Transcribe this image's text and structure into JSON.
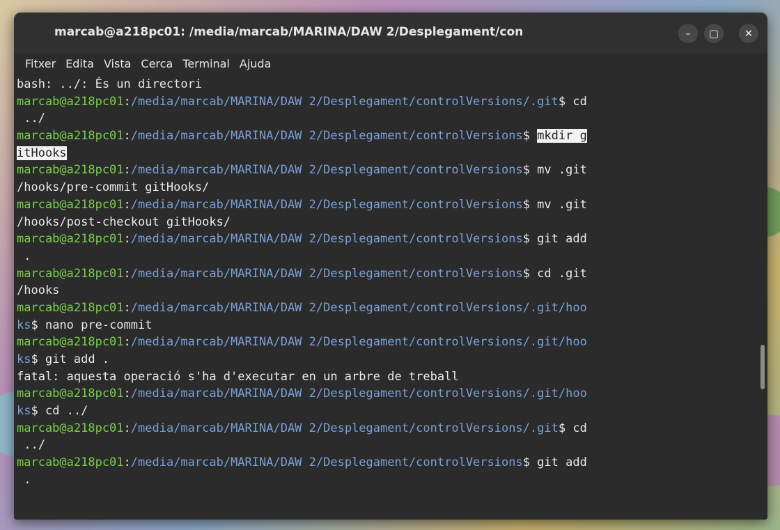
{
  "window": {
    "title": "marcab@a218pc01: /media/marcab/MARINA/DAW 2/Desplegament/con",
    "buttons": {
      "minimize": "–",
      "maximize": "▢",
      "close": "✕"
    }
  },
  "menu": [
    "Fitxer",
    "Edita",
    "Vista",
    "Cerca",
    "Terminal",
    "Ajuda"
  ],
  "colors": {
    "prompt_user": "#78d048",
    "prompt_path": "#7aa0d8",
    "text": "#e9e9e9",
    "background": "#2b2b2b"
  },
  "terminal": {
    "lines": [
      {
        "segments": [
          {
            "t": "bash: ../: És un directori",
            "c": "text"
          }
        ]
      },
      {
        "segments": [
          {
            "t": "marcab@a218pc01",
            "c": "user"
          },
          {
            "t": ":",
            "c": "text"
          },
          {
            "t": "/media/marcab/MARINA/DAW 2/Desplegament/controlVersions/.git",
            "c": "path"
          },
          {
            "t": "$ cd",
            "c": "text"
          }
        ]
      },
      {
        "segments": [
          {
            "t": " ../",
            "c": "text"
          }
        ]
      },
      {
        "segments": [
          {
            "t": "marcab@a218pc01",
            "c": "user"
          },
          {
            "t": ":",
            "c": "text"
          },
          {
            "t": "/media/marcab/MARINA/DAW 2/Desplegament/controlVersions",
            "c": "path"
          },
          {
            "t": "$ ",
            "c": "text"
          },
          {
            "t": "mkdir g",
            "c": "hl"
          }
        ]
      },
      {
        "segments": [
          {
            "t": "itHooks",
            "c": "hl"
          }
        ]
      },
      {
        "segments": [
          {
            "t": "marcab@a218pc01",
            "c": "user"
          },
          {
            "t": ":",
            "c": "text"
          },
          {
            "t": "/media/marcab/MARINA/DAW 2/Desplegament/controlVersions",
            "c": "path"
          },
          {
            "t": "$ mv .git",
            "c": "text"
          }
        ]
      },
      {
        "segments": [
          {
            "t": "/hooks/pre-commit gitHooks/",
            "c": "text"
          }
        ]
      },
      {
        "segments": [
          {
            "t": "marcab@a218pc01",
            "c": "user"
          },
          {
            "t": ":",
            "c": "text"
          },
          {
            "t": "/media/marcab/MARINA/DAW 2/Desplegament/controlVersions",
            "c": "path"
          },
          {
            "t": "$ mv .git",
            "c": "text"
          }
        ]
      },
      {
        "segments": [
          {
            "t": "/hooks/post-checkout gitHooks/",
            "c": "text"
          }
        ]
      },
      {
        "segments": [
          {
            "t": "marcab@a218pc01",
            "c": "user"
          },
          {
            "t": ":",
            "c": "text"
          },
          {
            "t": "/media/marcab/MARINA/DAW 2/Desplegament/controlVersions",
            "c": "path"
          },
          {
            "t": "$ git add",
            "c": "text"
          }
        ]
      },
      {
        "segments": [
          {
            "t": " .",
            "c": "text"
          }
        ]
      },
      {
        "segments": [
          {
            "t": "marcab@a218pc01",
            "c": "user"
          },
          {
            "t": ":",
            "c": "text"
          },
          {
            "t": "/media/marcab/MARINA/DAW 2/Desplegament/controlVersions",
            "c": "path"
          },
          {
            "t": "$ cd .git",
            "c": "text"
          }
        ]
      },
      {
        "segments": [
          {
            "t": "/hooks",
            "c": "text"
          }
        ]
      },
      {
        "segments": [
          {
            "t": "marcab@a218pc01",
            "c": "user"
          },
          {
            "t": ":",
            "c": "text"
          },
          {
            "t": "/media/marcab/MARINA/DAW 2/Desplegament/controlVersions/.git/hoo",
            "c": "path"
          }
        ]
      },
      {
        "segments": [
          {
            "t": "ks",
            "c": "path"
          },
          {
            "t": "$ nano pre-commit",
            "c": "text"
          }
        ]
      },
      {
        "segments": [
          {
            "t": "marcab@a218pc01",
            "c": "user"
          },
          {
            "t": ":",
            "c": "text"
          },
          {
            "t": "/media/marcab/MARINA/DAW 2/Desplegament/controlVersions/.git/hoo",
            "c": "path"
          }
        ]
      },
      {
        "segments": [
          {
            "t": "ks",
            "c": "path"
          },
          {
            "t": "$ git add .",
            "c": "text"
          }
        ]
      },
      {
        "segments": [
          {
            "t": "fatal: aquesta operació s'ha d'executar en un arbre de treball",
            "c": "text"
          }
        ]
      },
      {
        "segments": [
          {
            "t": "marcab@a218pc01",
            "c": "user"
          },
          {
            "t": ":",
            "c": "text"
          },
          {
            "t": "/media/marcab/MARINA/DAW 2/Desplegament/controlVersions/.git/hoo",
            "c": "path"
          }
        ]
      },
      {
        "segments": [
          {
            "t": "ks",
            "c": "path"
          },
          {
            "t": "$ cd ../",
            "c": "text"
          }
        ]
      },
      {
        "segments": [
          {
            "t": "marcab@a218pc01",
            "c": "user"
          },
          {
            "t": ":",
            "c": "text"
          },
          {
            "t": "/media/marcab/MARINA/DAW 2/Desplegament/controlVersions/.git",
            "c": "path"
          },
          {
            "t": "$ cd",
            "c": "text"
          }
        ]
      },
      {
        "segments": [
          {
            "t": " ../",
            "c": "text"
          }
        ]
      },
      {
        "segments": [
          {
            "t": "marcab@a218pc01",
            "c": "user"
          },
          {
            "t": ":",
            "c": "text"
          },
          {
            "t": "/media/marcab/MARINA/DAW 2/Desplegament/controlVersions",
            "c": "path"
          },
          {
            "t": "$ git add",
            "c": "text"
          }
        ]
      },
      {
        "segments": [
          {
            "t": " .",
            "c": "text"
          }
        ]
      }
    ]
  }
}
